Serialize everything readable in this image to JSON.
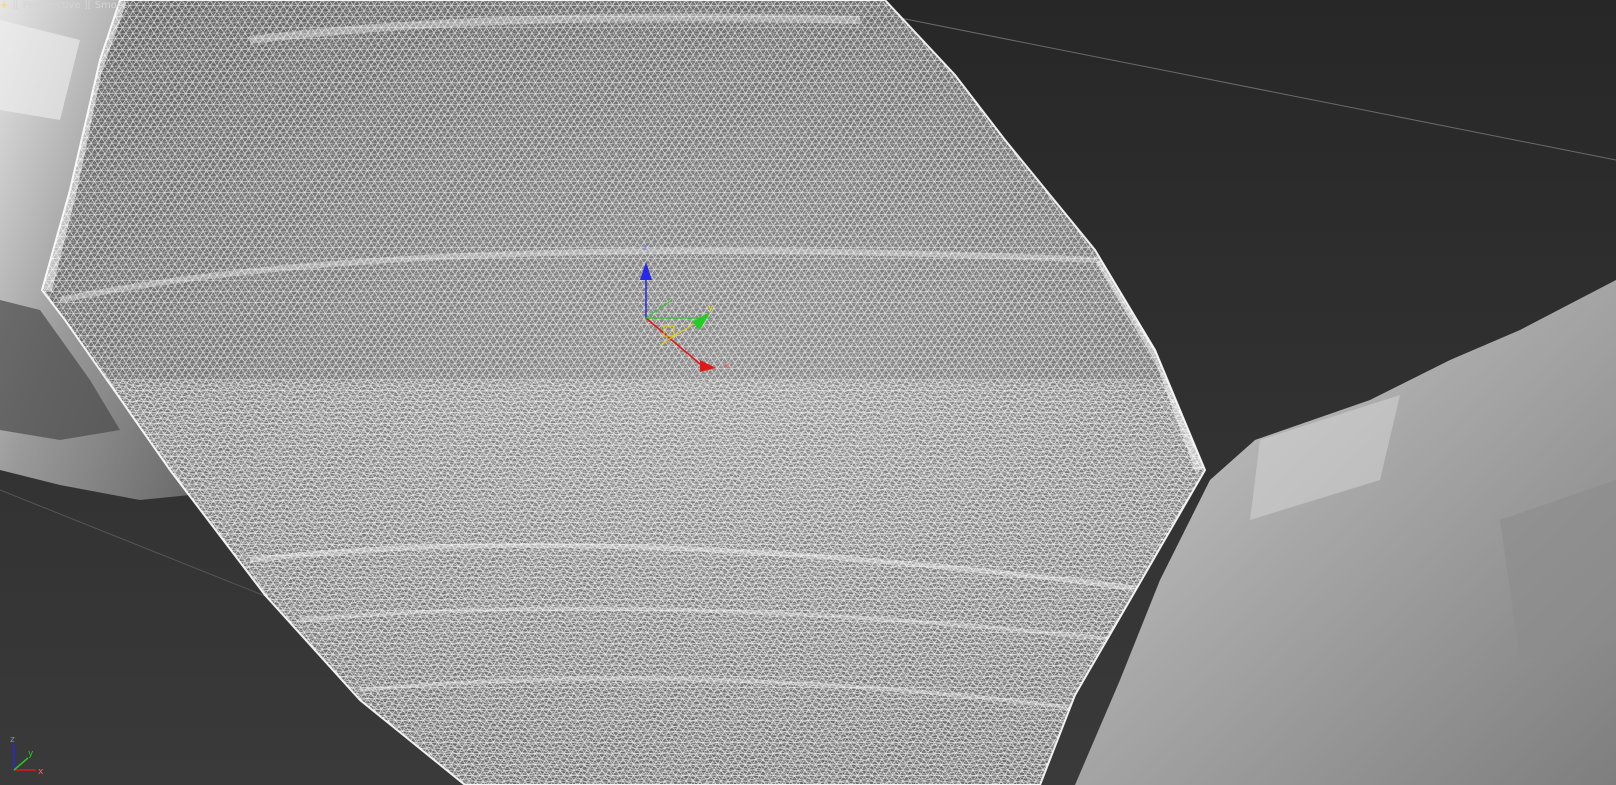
{
  "viewport": {
    "label": {
      "plus": "+",
      "view": "Perspective",
      "shading": "Smoot"
    }
  },
  "gizmo": {
    "axes": [
      "x",
      "y",
      "z"
    ],
    "colors": {
      "x": "#e01818",
      "y": "#22cc22",
      "z": "#2828e8"
    }
  },
  "view_cube_axes": {
    "axes": [
      "x",
      "y",
      "z"
    ]
  },
  "colors": {
    "background": "#2e2e2e",
    "wireframe": "#ffffff",
    "shaded_rock": "#bcbcbc"
  }
}
